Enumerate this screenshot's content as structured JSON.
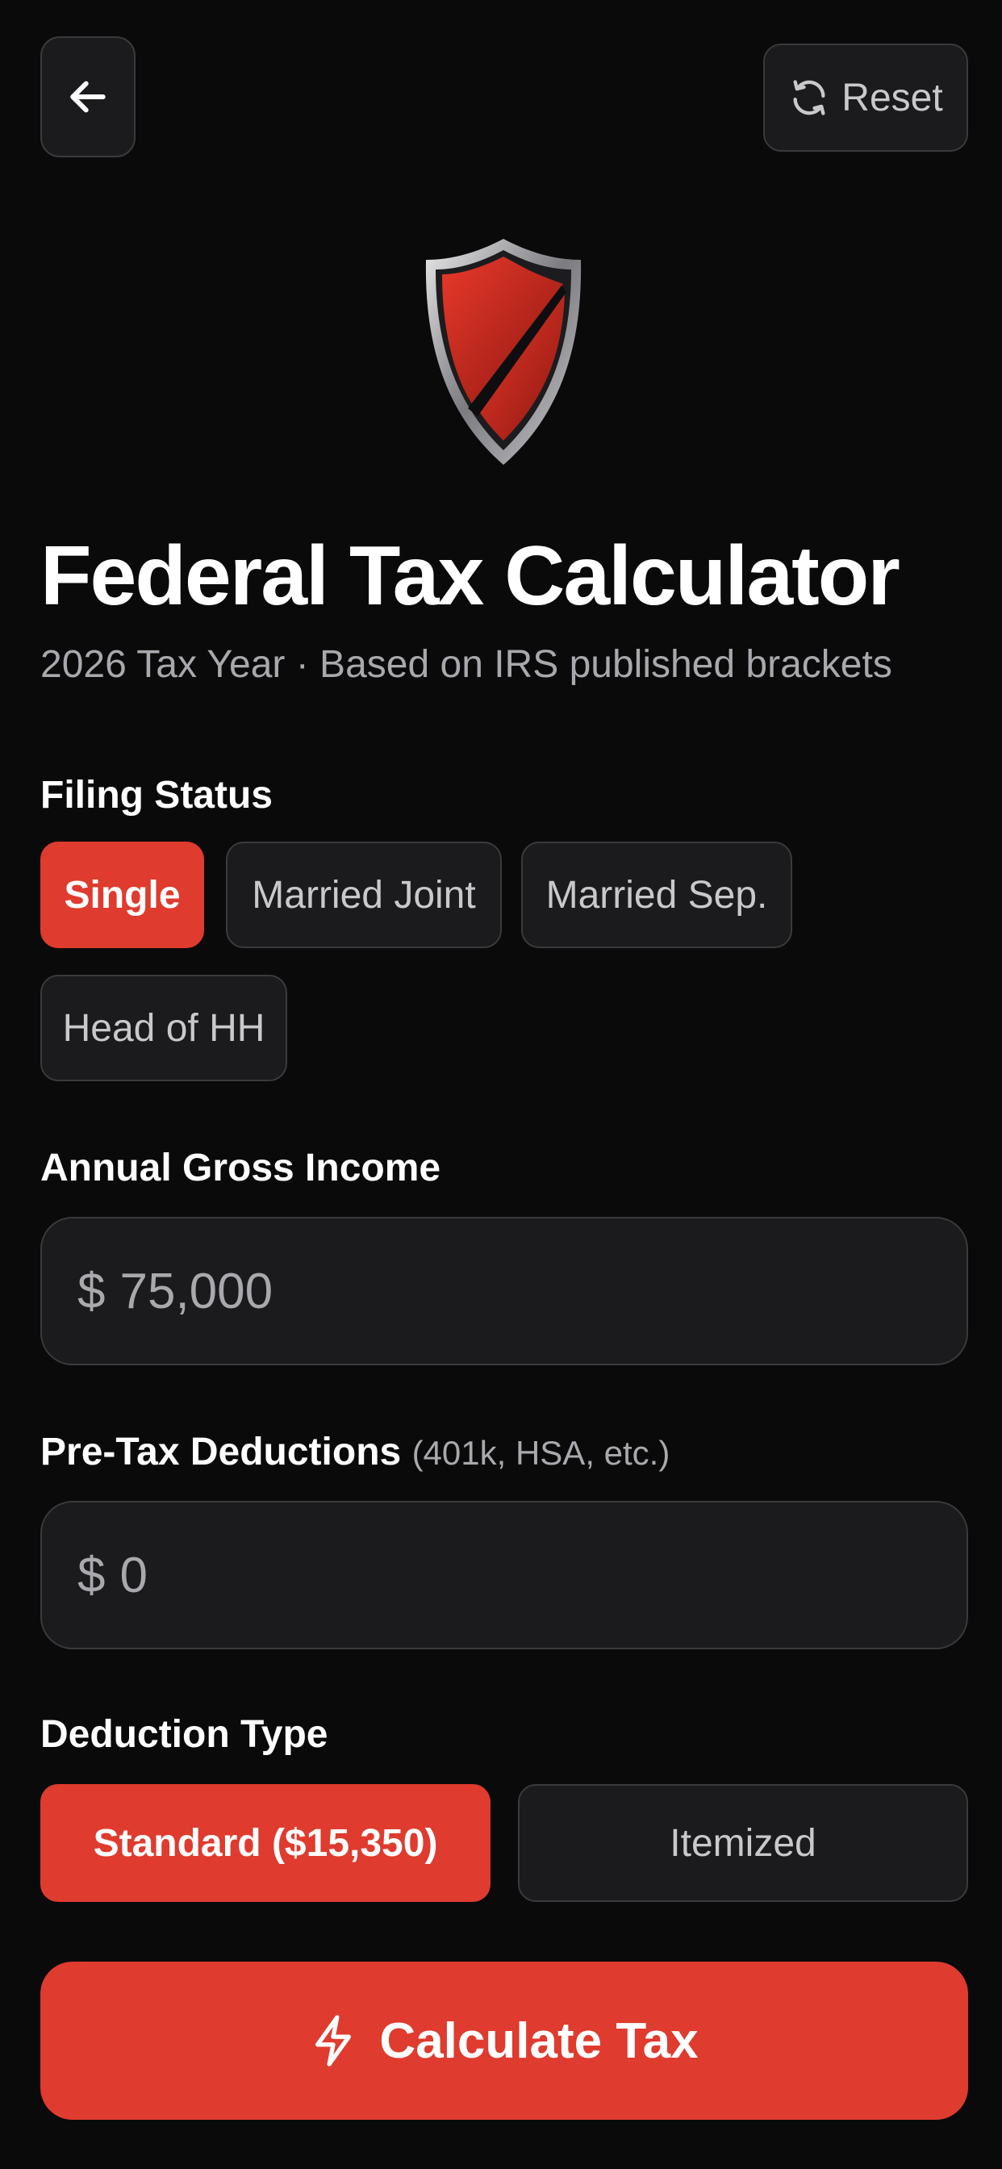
{
  "header": {
    "back_icon": "arrow-left-icon",
    "reset_icon": "refresh-icon",
    "reset_label": "Reset"
  },
  "logo": {
    "icon": "shield-icon"
  },
  "title": "Federal Tax Calculator",
  "subtitle": "2026 Tax Year · Based on IRS published brackets",
  "filing_status": {
    "label": "Filing Status",
    "options": [
      "Single",
      "Married Joint",
      "Married Sep.",
      "Head of HH"
    ],
    "selected": "Single"
  },
  "gross_income": {
    "label": "Annual Gross Income",
    "currency": "$",
    "value": "75,000"
  },
  "pretax": {
    "label": "Pre-Tax Deductions",
    "hint": "(401k, HSA, etc.)",
    "currency": "$",
    "value": "0"
  },
  "deduction_type": {
    "label": "Deduction Type",
    "options": [
      "Standard ($15,350)",
      "Itemized"
    ],
    "selected": "Standard ($15,350)"
  },
  "calculate": {
    "icon": "lightning-icon",
    "label": "Calculate Tax"
  },
  "colors": {
    "accent": "#df3b2e",
    "background": "#0a0a0b",
    "surface": "#1b1b1d"
  }
}
